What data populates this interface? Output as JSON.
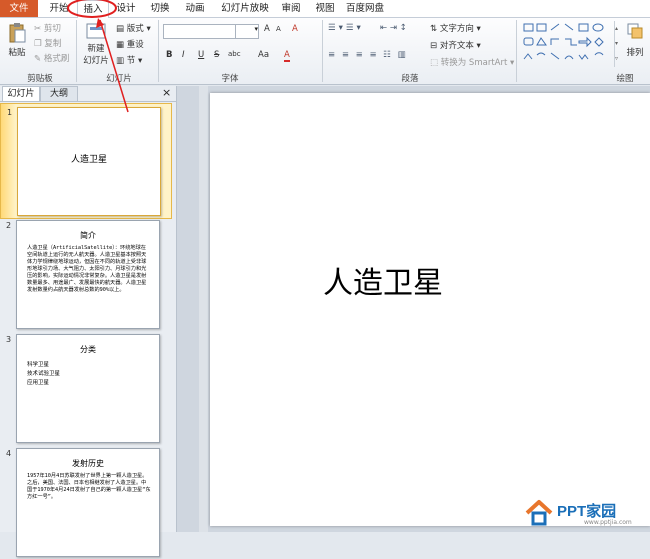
{
  "tabs": [
    "文件",
    "开始",
    "插入",
    "设计",
    "切换",
    "动画",
    "幻灯片放映",
    "审阅",
    "视图",
    "百度网盘"
  ],
  "clipboard": {
    "paste": "粘贴",
    "cut": "剪切",
    "copy": "复制",
    "format_painter": "格式刷",
    "group": "剪贴板"
  },
  "slides_group": {
    "new_slide": "新建",
    "new_slide2": "幻灯片",
    "layout": "版式",
    "reset": "重设",
    "section": "节",
    "group": "幻灯片"
  },
  "font_group": {
    "group": "字体",
    "bold": "B",
    "italic": "I",
    "underline": "U",
    "strike": "S",
    "shadow": "abc",
    "aa": "Aa",
    "grow": "A",
    "shrink": "A",
    "clear": "A",
    "color": "A"
  },
  "paragraph_group": {
    "text_direction": "文字方向",
    "align_text": "对齐文本",
    "smartart": "转换为 SmartArt",
    "group": "段落"
  },
  "drawing_group": {
    "arrange": "排列",
    "group": "绘图"
  },
  "panel": {
    "tab_slides": "幻灯片",
    "tab_outline": "大纲",
    "close": "×"
  },
  "slides": [
    {
      "num": "1",
      "title": "人造卫星"
    },
    {
      "num": "2",
      "title": "简介",
      "body": "人造卫星（ArtificialSatellite）：环绕地球在空间轨道上运行的无人航天器。人造卫星基本按照天体力学规律绕地球运动，但因在不同的轨道上受非球形地球引力场、大气阻力、太阳引力、月球引力和光压的影响，实际运动情况非常复杂。人造卫星是发射数量最多、用途最广、发展最快的航天器。人造卫星发射数量约占航天器发射总数的90%以上。"
    },
    {
      "num": "3",
      "title": "分类",
      "items": [
        "科学卫星",
        "技术试验卫星",
        "应用卫星"
      ]
    },
    {
      "num": "4",
      "title": "发射历史",
      "body": "1957年10月4日苏联发射了世界上第一颗人造卫星。之后，美国、法国、日本也相继发射了人造卫星。中国于1970年4月24日发射了自己的第一颗人造卫星“东方红一号”。"
    }
  ],
  "main_slide": {
    "title": "人造卫星"
  },
  "watermark": {
    "text": "PPT家园",
    "url": "www.pptjia.com"
  }
}
